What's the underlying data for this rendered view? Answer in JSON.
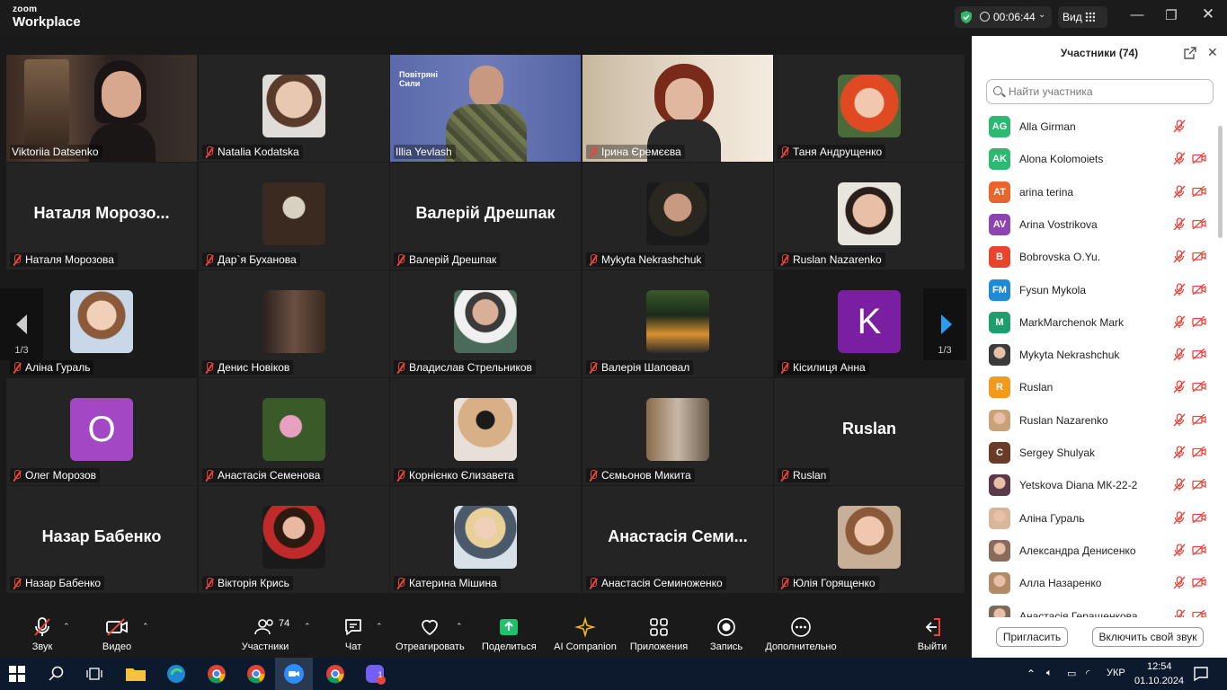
{
  "app": {
    "logo_top": "zoom",
    "logo_bottom": "Workplace"
  },
  "titlebar": {
    "timer": "00:06:44",
    "view_label": "Вид"
  },
  "gallery": {
    "tiles": [
      {
        "name": "Viktoriia Datsenko",
        "type": "video",
        "muted": false
      },
      {
        "name": "Natalia Kodatska",
        "type": "photo",
        "muted": true
      },
      {
        "name": "Illia Yevlash",
        "type": "video",
        "muted": false,
        "banner": "Повітряні Сили"
      },
      {
        "name": "Ірина Єремєєва",
        "type": "video",
        "muted": true
      },
      {
        "name": "Таня Андрущенко",
        "type": "photo",
        "muted": true
      },
      {
        "name": "Наталя Морозова",
        "type": "text",
        "muted": true,
        "big": "Наталя  Морозо..."
      },
      {
        "name": "Дар`я Буханова",
        "type": "photo",
        "muted": true
      },
      {
        "name": "Валерій Дрешпак",
        "type": "text",
        "muted": true,
        "big": "Валерій Дрешпак"
      },
      {
        "name": "Mykyta Nekrashchuk",
        "type": "photo",
        "muted": true
      },
      {
        "name": "Ruslan Nazarenko",
        "type": "photo",
        "muted": true
      },
      {
        "name": "Аліна Гураль",
        "type": "photo",
        "muted": true
      },
      {
        "name": "Денис Новіков",
        "type": "photo",
        "muted": true
      },
      {
        "name": "Владислав Стрельников",
        "type": "photo",
        "muted": true
      },
      {
        "name": "Валерія Шаповал",
        "type": "photo",
        "muted": true
      },
      {
        "name": "Кісилиця Анна",
        "type": "letter",
        "muted": true,
        "letter": "K"
      },
      {
        "name": "Олег Морозов",
        "type": "letter",
        "muted": true,
        "letter": "O"
      },
      {
        "name": "Анастасія Семенова",
        "type": "photo",
        "muted": true
      },
      {
        "name": "Корнієнко Єлизавета",
        "type": "photo",
        "muted": true
      },
      {
        "name": "Сємьонов Микита",
        "type": "photo",
        "muted": true
      },
      {
        "name": "Ruslan",
        "type": "text",
        "muted": true,
        "big": "Ruslan"
      },
      {
        "name": "Назар Бабенко",
        "type": "text",
        "muted": true,
        "big": "Назар Бабенко"
      },
      {
        "name": "Вікторія Крись",
        "type": "photo",
        "muted": true
      },
      {
        "name": "Катерина Мішина",
        "type": "photo",
        "muted": true
      },
      {
        "name": "Анастасія Семиноженко",
        "type": "text",
        "muted": true,
        "big": "Анастасія Семи..."
      },
      {
        "name": "Юлія Горященко",
        "type": "photo",
        "muted": true
      }
    ],
    "page_left": "1/3",
    "page_right": "1/3"
  },
  "panel": {
    "title": "Участники (74)",
    "search_placeholder": "Найти участника",
    "participants": [
      {
        "initials": "AG",
        "name": "Alla Girman",
        "color": "#2eb872"
      },
      {
        "initials": "AK",
        "name": "Alona Kolomoiets",
        "color": "#2eb872"
      },
      {
        "initials": "AT",
        "name": "arina terina",
        "color": "#e8662c"
      },
      {
        "initials": "AV",
        "name": "Arina Vostrikova",
        "color": "#8e44ad"
      },
      {
        "initials": "B",
        "name": "Bobrovska O.Yu.",
        "color": "#e8452c"
      },
      {
        "initials": "FM",
        "name": "Fysun Mykola",
        "color": "#1f8ad6"
      },
      {
        "initials": "M",
        "name": "MarkMarchenok Mark",
        "color": "#1e9e6a"
      },
      {
        "initials": "",
        "name": "Mykyta Nekrashchuk",
        "color": "#3a3a3a"
      },
      {
        "initials": "R",
        "name": "Ruslan",
        "color": "#f29a1e"
      },
      {
        "initials": "",
        "name": "Ruslan Nazarenko",
        "color": "#c9a27a"
      },
      {
        "initials": "C",
        "name": "Sergey Shulyak",
        "color": "#6b3b2a"
      },
      {
        "initials": "",
        "name": "Yetskova Diana МК-22-2",
        "color": "#5a3a4a"
      },
      {
        "initials": "",
        "name": "Аліна Гураль",
        "color": "#d9b59a"
      },
      {
        "initials": "",
        "name": "Александра Денисенко",
        "color": "#8a6a5a"
      },
      {
        "initials": "",
        "name": "Алла Назаренко",
        "color": "#b28a6a"
      },
      {
        "initials": "",
        "name": "Анастасія Геращенкова",
        "color": "#7a6a5a"
      }
    ],
    "invite_label": "Пригласить",
    "unmute_label": "Включить свой звук"
  },
  "toolbar": {
    "audio": "Звук",
    "video": "Видео",
    "participants": "Участники",
    "participants_count": "74",
    "chat": "Чат",
    "react": "Отреагировать",
    "share": "Поделиться",
    "ai": "AI Companion",
    "apps": "Приложения",
    "record": "Запись",
    "more": "Дополнительно",
    "leave": "Выйти"
  },
  "taskbar": {
    "lang": "УКР",
    "time": "12:54",
    "date": "01.10.2024",
    "notif": "1"
  }
}
